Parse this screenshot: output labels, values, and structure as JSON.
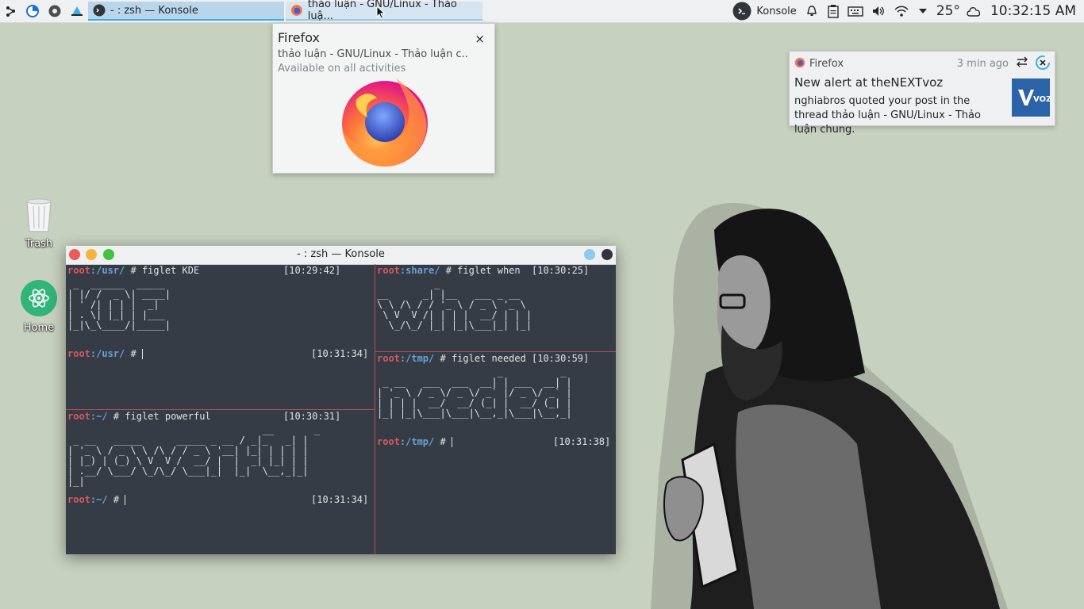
{
  "panel": {
    "tasks": [
      {
        "label": "- : zsh — Konsole"
      },
      {
        "label": "thảo luận - GNU/Linux - Thảo luậ..."
      }
    ],
    "active_window": "Konsole",
    "temperature": "25°",
    "clock": "10:32:15 AM"
  },
  "desktop": {
    "icons": [
      {
        "label": "Trash"
      },
      {
        "label": "Home"
      }
    ]
  },
  "tooltip": {
    "title": "Firefox",
    "subtitle": "thảo luận - GNU/Linux - Thảo luận c...",
    "activities": "Available on all activities",
    "close": "×"
  },
  "notification": {
    "app": "Firefox",
    "time": "3 min ago",
    "title": "New alert at theNEXTvoz",
    "body": "nghiabros quoted your post in the thread thảo luận - GNU/Linux - Thảo luận chung.",
    "logo_text": "VOZ"
  },
  "konsole": {
    "title": "- : zsh — Konsole",
    "panes": [
      {
        "name": "usr",
        "cmd_root": "root",
        "cmd_path": ":/usr/",
        "cmd": " # figlet KDE",
        "cmd_time": "[10:29:42]",
        "art": " _  ______  _____\n| |/ /  _ \\| ____|\n| ' /| | | |  _|\n| . \\| |_| | |___\n|_|\\_\\____/|_____|",
        "prompt_root": "root",
        "prompt_path": ":/usr/",
        "prompt": " # ",
        "prompt_time": "[10:31:34]"
      },
      {
        "name": "share",
        "cmd_root": "root",
        "cmd_path": ":share/",
        "cmd": " # figlet when",
        "cmd_time": "[10:30:25]",
        "art": "          _\n__      _| |__   ___ _ __\n\\ \\ /\\ / / '_ \\ / _ \\ '_ \\\n \\ V  V /| | | |  __/ | | |\n  \\_/\\_/ |_| |_|\\___|_| |_|"
      },
      {
        "name": "home",
        "cmd_root": "root",
        "cmd_path": ":~/",
        "cmd": " # figlet powerful",
        "cmd_time": "[10:30:31]",
        "art": "                                  __       _\n _ __   _____      _____ _ __ / _|_   _| |\n| '_ \\ / _ \\ \\ /\\ / / _ \\ '__| |_| | | | |\n| |_) | (_) \\ V  V /  __/ |  |  _| |_| | |\n| .__/ \\___/ \\_/\\_/ \\___|_|  |_|  \\__,_|_|\n|_|",
        "prompt_root": "root",
        "prompt_path": ":~/",
        "prompt": " # ",
        "prompt_time": "[10:31:34]"
      },
      {
        "name": "tmp",
        "cmd_root": "root",
        "cmd_path": ":/tmp/",
        "cmd": " # figlet needed",
        "cmd_time": "[10:30:59]",
        "art": "                     _          _\n _ __   ___  ___  __| | ___  __| |\n| '_ \\ / _ \\/ _ \\/ _` |/ _ \\/ _` |\n| | | |  __/  __/ (_| |  __/ (_| |\n|_| |_|\\___|\\___|\\__,_|\\___|\\__,_|",
        "prompt_root": "root",
        "prompt_path": ":/tmp/",
        "prompt": " # ",
        "prompt_time": "[10:31:38]"
      }
    ]
  }
}
